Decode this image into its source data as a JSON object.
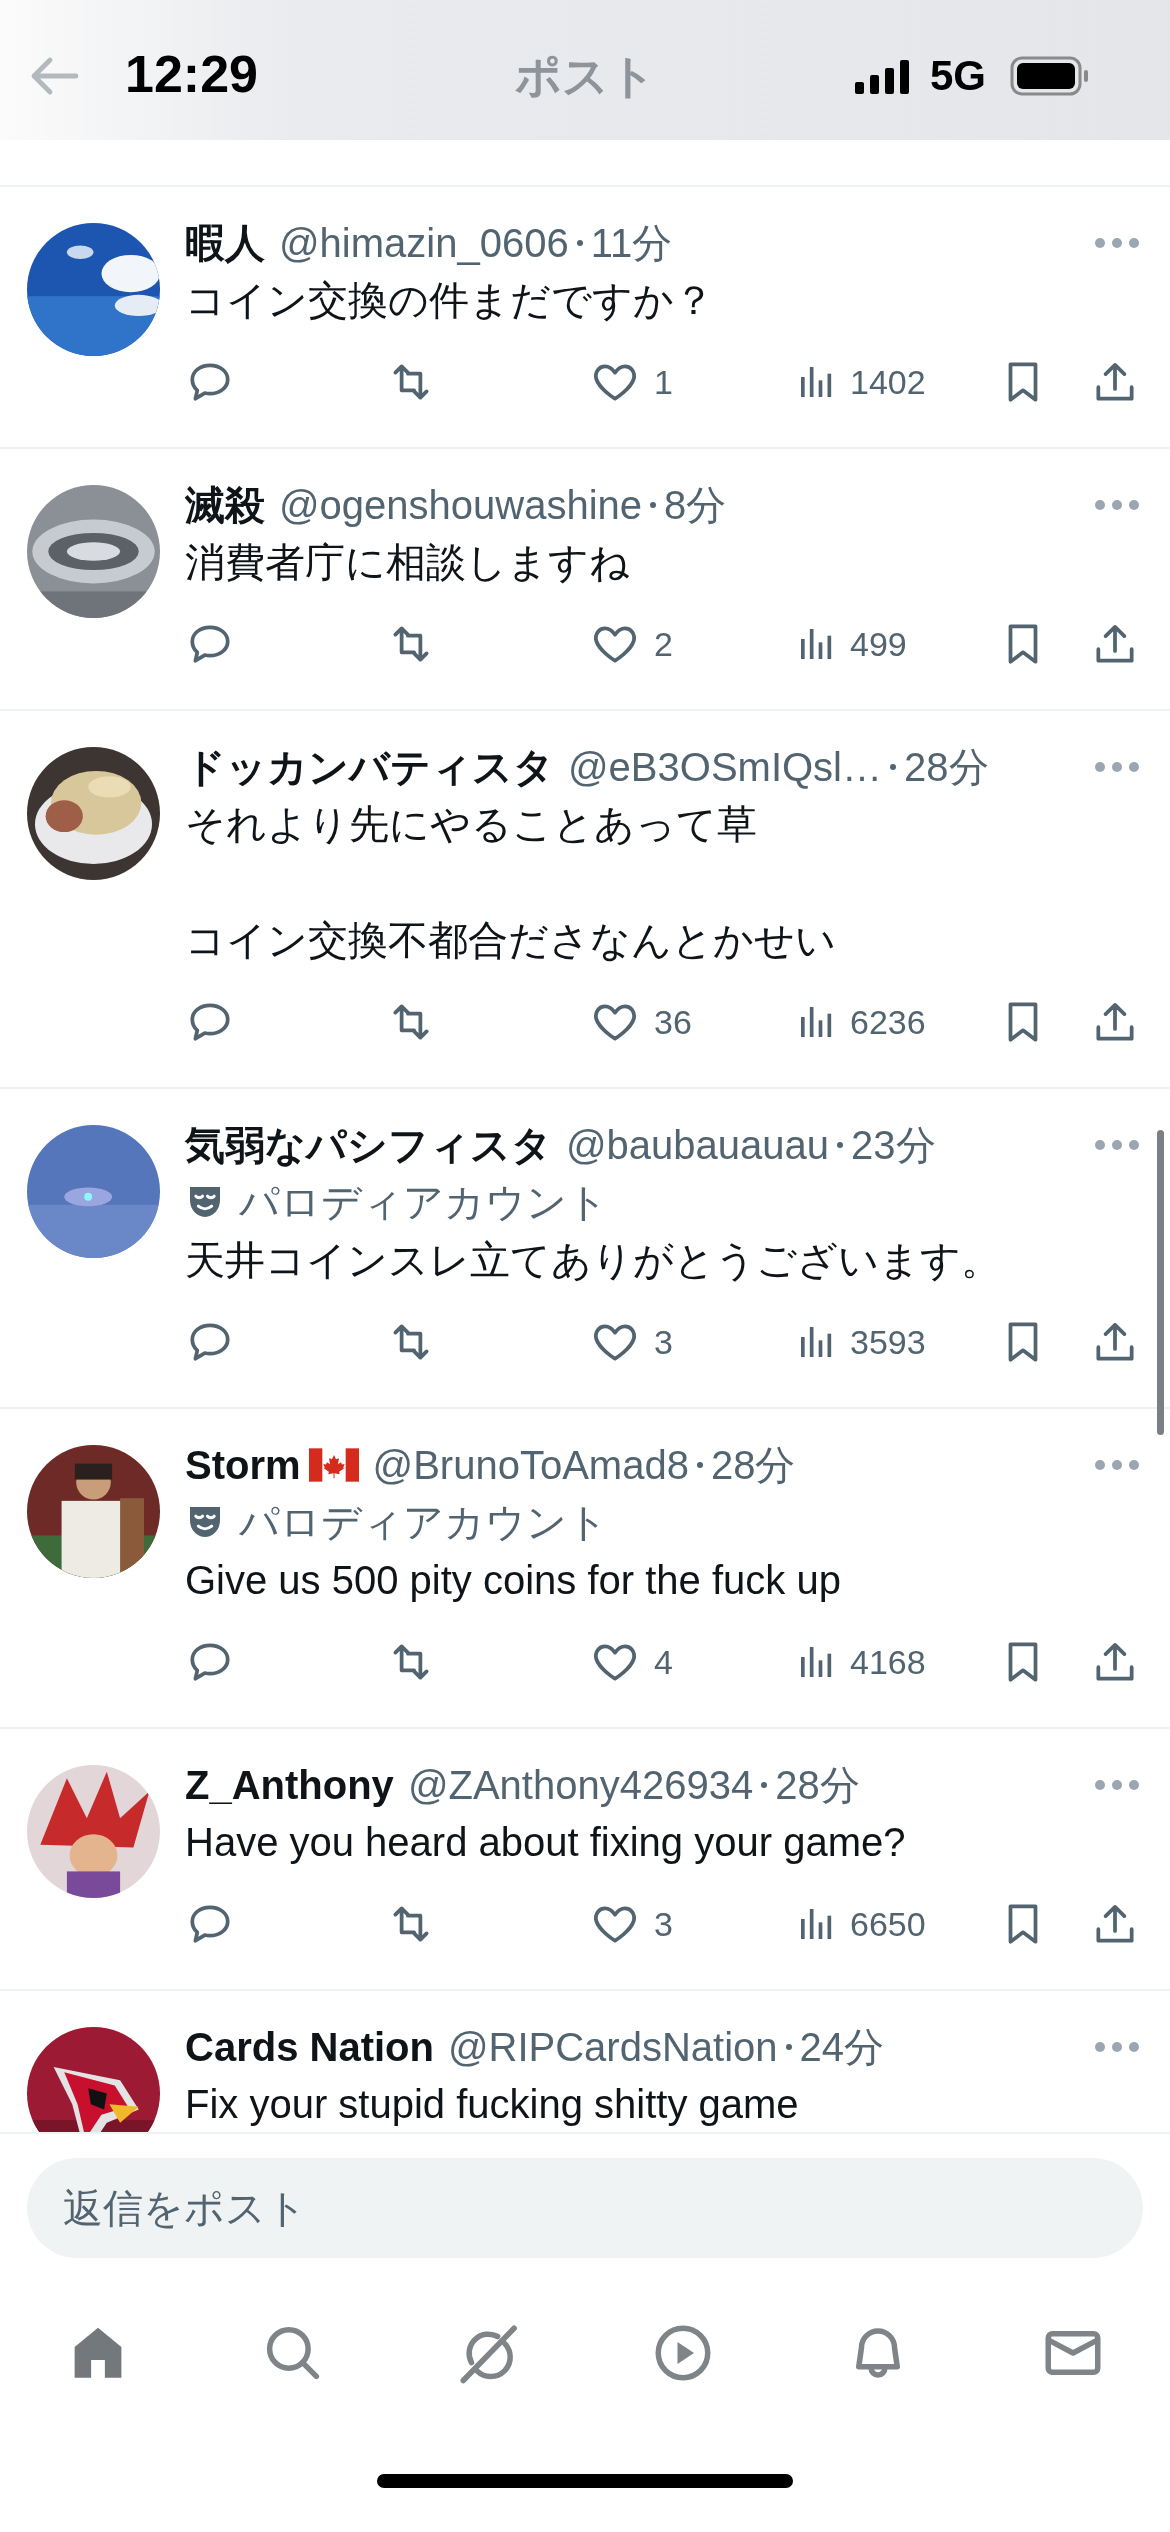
{
  "status_bar": {
    "time": "12:29",
    "network": "5G"
  },
  "header": {
    "title": "ポスト"
  },
  "posts": [
    {
      "name": "暇人",
      "flag": false,
      "handle": "@himazin_0606",
      "time": "11分",
      "paragraphs": [
        "コイン交換の件まだですか？"
      ],
      "likes": "1",
      "views": "1402"
    },
    {
      "name": "滅殺",
      "flag": false,
      "handle": "@ogenshouwashine",
      "time": "8分",
      "paragraphs": [
        "消費者庁に相談しますね"
      ],
      "likes": "2",
      "views": "499"
    },
    {
      "name": "ドッカンバティスタ",
      "flag": false,
      "handle": "@eB3OSmIQsl…",
      "time": "28分",
      "paragraphs": [
        "それより先にやることあって草",
        "コイン交換不都合ださなんとかせい"
      ],
      "likes": "36",
      "views": "6236"
    },
    {
      "name": "気弱なパシフィスタ",
      "flag": false,
      "handle": "@baubauauau",
      "time": "23分",
      "label": "パロディアカウント",
      "paragraphs": [
        "天井コインスレ立てありがとうございます。"
      ],
      "likes": "3",
      "views": "3593"
    },
    {
      "name": "Storm",
      "flag": true,
      "handle": "@BrunoToAmad8",
      "time": "28分",
      "label": "パロディアカウント",
      "paragraphs": [
        "Give us 500 pity coins for the fuck up"
      ],
      "likes": "4",
      "views": "4168"
    },
    {
      "name": "Z_Anthony",
      "flag": false,
      "handle": "@ZAnthony426934",
      "time": "28分",
      "paragraphs": [
        "Have you heard about fixing your game?"
      ],
      "likes": "3",
      "views": "6650"
    },
    {
      "name": "Cards Nation",
      "flag": false,
      "handle": "@RIPCardsNation",
      "time": "24分",
      "paragraphs": [
        "Fix your stupid fucking shitty game"
      ]
    }
  ],
  "reply_field": {
    "placeholder": "返信をポスト"
  },
  "nav": [
    {
      "kind": "home",
      "selected": true
    },
    {
      "kind": "search",
      "selected": false
    },
    {
      "kind": "grok",
      "selected": false
    },
    {
      "kind": "video",
      "selected": false
    },
    {
      "kind": "notifications",
      "selected": false
    },
    {
      "kind": "messages",
      "selected": false
    }
  ]
}
